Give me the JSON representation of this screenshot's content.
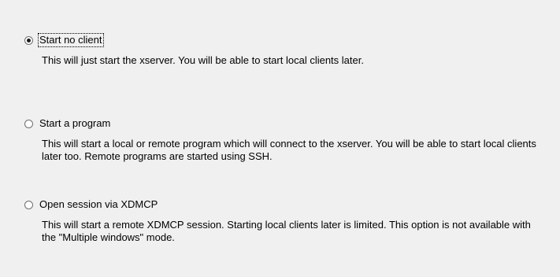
{
  "options": [
    {
      "label": "Start no client",
      "description": "This will just start the xserver. You will be able to start local clients later.",
      "selected": true
    },
    {
      "label": "Start a program",
      "description": "This will start a local or remote program which will connect to the xserver. You will be able to start local clients later too. Remote programs are started using SSH.",
      "selected": false
    },
    {
      "label": "Open session via XDMCP",
      "description": "This will start a remote XDMCP session. Starting local clients later is limited. This option is not available with the \"Multiple windows\" mode.",
      "selected": false
    }
  ]
}
